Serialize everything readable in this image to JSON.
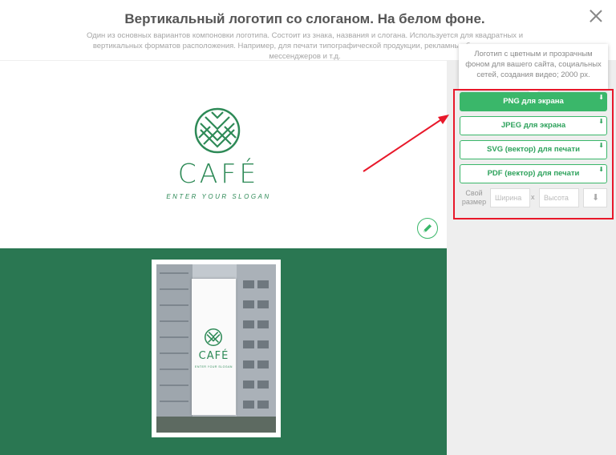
{
  "header": {
    "title": "Вертикальный логотип со слоганом. На белом фоне.",
    "subtitle": "Один из основных вариантов компоновки логотипа. Состоит из знака, названия и слогана. Используется для квадратных и вертикальных форматов расположения. Например, для печати типографической продукции, рекламных баннеров, для мессенджеров и т.д."
  },
  "tooltip": {
    "text": "Логотип с цветным и прозрачным фоном для вашего сайта, социальных сетей, создания видео; 2000 px."
  },
  "logo": {
    "brand": "CAFÉ",
    "slogan": "ENTER YOUR SLOGAN",
    "color": "#2e8a57"
  },
  "mockup": {
    "background": "#2a7752",
    "banner_brand": "CAFÉ",
    "banner_slogan": "ENTER YOUR SLOGAN"
  },
  "downloads": [
    {
      "label": "PNG для экрана",
      "icon": "download-icon"
    },
    {
      "label": "JPEG для экрана",
      "icon": "download-icon"
    },
    {
      "label": "SVG (вектор) для печати",
      "icon": "download-icon"
    },
    {
      "label": "PDF (вектор) для печати",
      "icon": "download-icon"
    }
  ],
  "custom_size": {
    "label": "Свой размер",
    "width_placeholder": "Ширина",
    "height_placeholder": "Высота",
    "separator": "x"
  },
  "colors": {
    "accent": "#3ab76a",
    "highlight": "#e8182a"
  }
}
